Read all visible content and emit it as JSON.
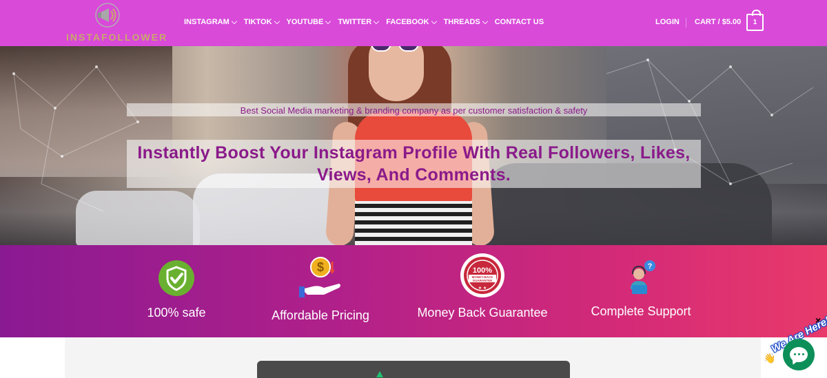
{
  "brand": {
    "logo_text": "INSTAFOLLOWER"
  },
  "nav": {
    "items": [
      {
        "label": "INSTAGRAM",
        "dropdown": true
      },
      {
        "label": "TIKTOK",
        "dropdown": true
      },
      {
        "label": "YOUTUBE",
        "dropdown": true
      },
      {
        "label": "TWITTER",
        "dropdown": true
      },
      {
        "label": "FACEBOOK",
        "dropdown": true
      },
      {
        "label": "THREADS",
        "dropdown": true
      },
      {
        "label": "CONTACT US",
        "dropdown": false
      }
    ],
    "login": "LOGIN",
    "cart": "CART / $5.00",
    "cart_count": "1"
  },
  "hero": {
    "tagline": "Best Social Media marketing & branding company as per customer satisfaction & safety",
    "headline_line1": "Instantly Boost Your Instagram Profile With Real Followers, Likes,",
    "headline_line2": "Views, And Comments."
  },
  "features": [
    {
      "label": "100% safe",
      "icon": "shield-check-icon"
    },
    {
      "label": "Affordable Pricing",
      "icon": "dollar-hand-icon"
    },
    {
      "label": "Money Back Guarantee",
      "icon": "guarantee-badge-icon",
      "badge_top": "100%",
      "badge_mid": "MONEY-BACK",
      "badge_bottom": "GUARANTEE"
    },
    {
      "label": "Complete Support",
      "icon": "support-agent-icon"
    }
  ],
  "chat": {
    "label": "We Are Here!",
    "close": "×"
  },
  "colors": {
    "header": "#d94ad9",
    "accent": "#8a1a8a",
    "features_start": "#8a1a92",
    "features_end": "#e83a6a",
    "chat": "#0d8f5a"
  }
}
